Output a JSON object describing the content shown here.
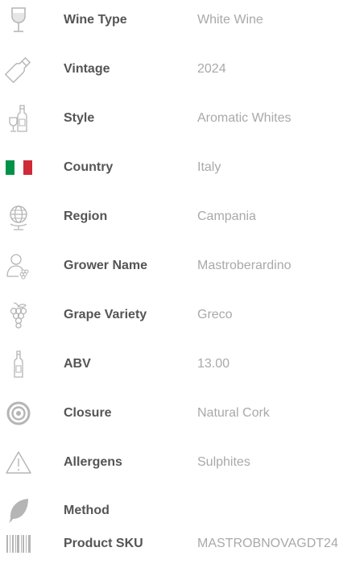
{
  "specs": [
    {
      "icon": "wine-glass-icon",
      "label": "Wine Type",
      "value": "White Wine"
    },
    {
      "icon": "bottle-icon",
      "label": "Vintage",
      "value": "2024"
    },
    {
      "icon": "bottle-and-glass-icon",
      "label": "Style",
      "value": "Aromatic Whites"
    },
    {
      "icon": "italy-flag-icon",
      "label": "Country",
      "value": "Italy"
    },
    {
      "icon": "globe-icon",
      "label": "Region",
      "value": "Campania"
    },
    {
      "icon": "grower-icon",
      "label": "Grower Name",
      "value": "Mastroberardino"
    },
    {
      "icon": "grapes-icon",
      "label": "Grape Variety",
      "value": "Greco"
    },
    {
      "icon": "small-bottle-icon",
      "label": "ABV",
      "value": "13.00"
    },
    {
      "icon": "target-icon",
      "label": "Closure",
      "value": "Natural Cork"
    },
    {
      "icon": "warning-icon",
      "label": "Allergens",
      "value": "Sulphites"
    },
    {
      "icon": "leaf-icon",
      "label": "Method",
      "value": ""
    },
    {
      "icon": "barcode-icon",
      "label": "Product SKU",
      "value": "MASTROBNOVAGDT24"
    }
  ],
  "colors": {
    "label": "#555555",
    "value": "#a9a9a9",
    "icon": "#b5b5b5",
    "flag_green": "#009246",
    "flag_red": "#ce2b37"
  }
}
